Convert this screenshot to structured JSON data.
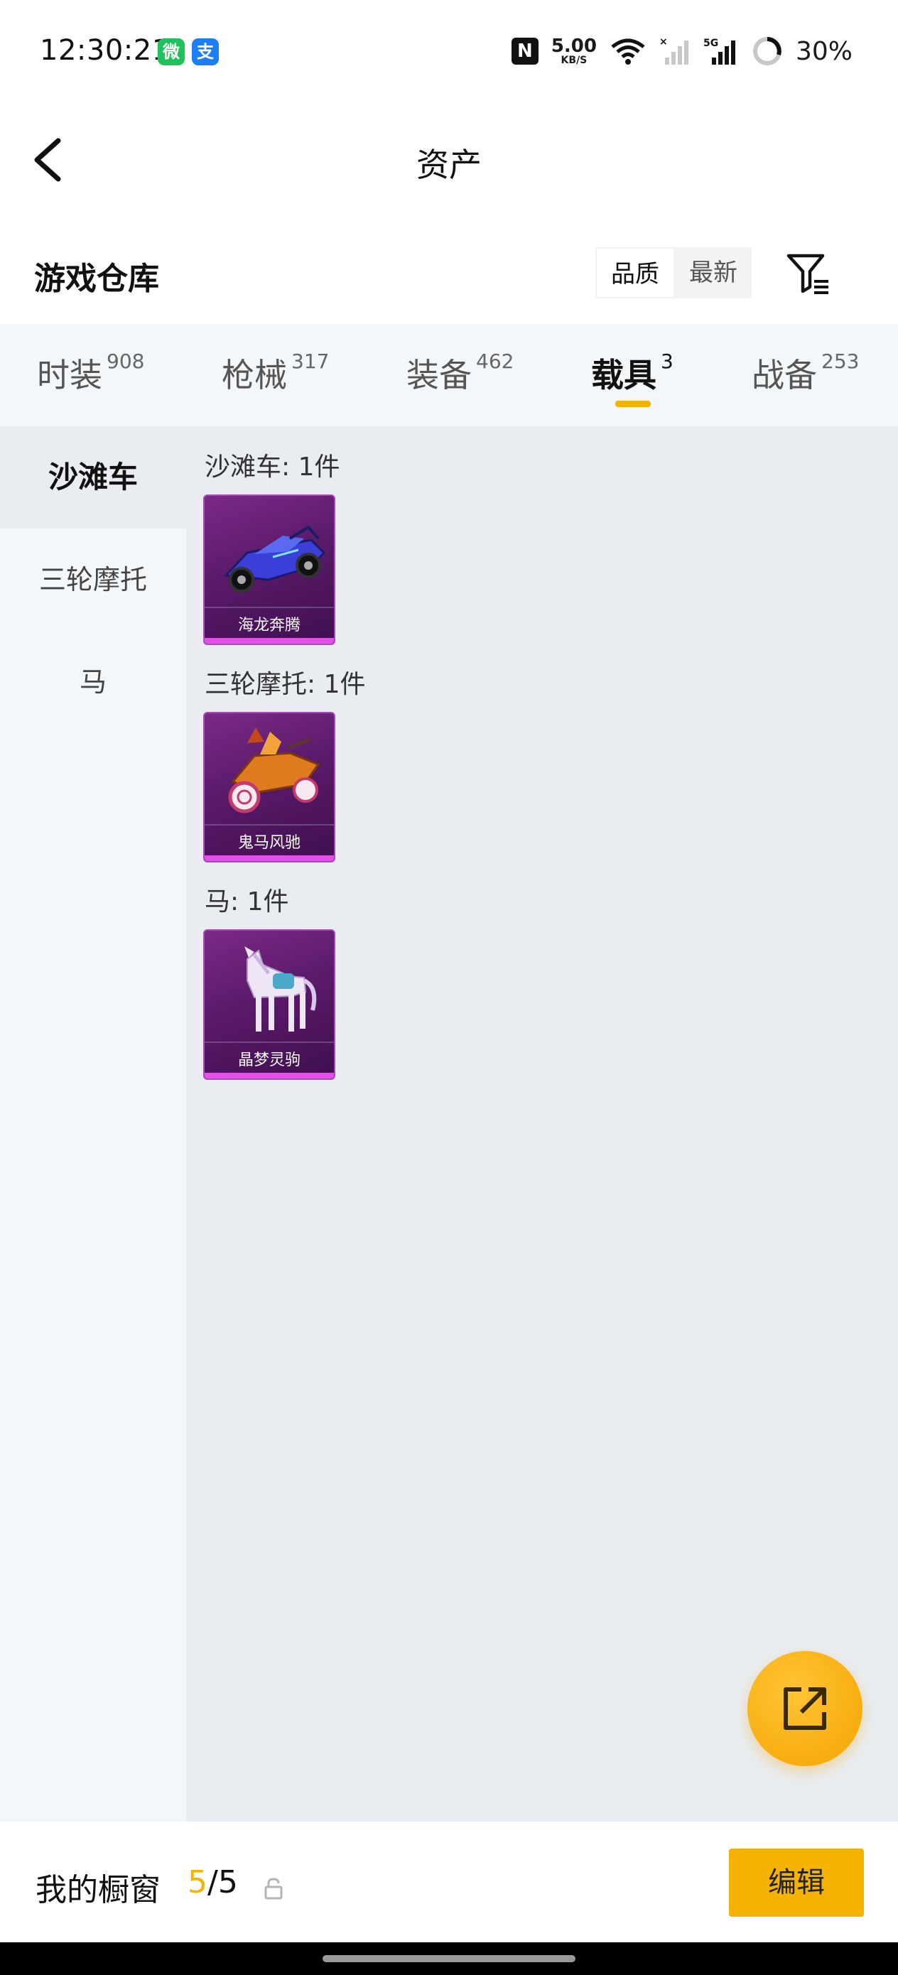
{
  "status_bar": {
    "time": "12:30:21",
    "app_badge_1": "微",
    "app_badge_2": "支",
    "nfc": "N",
    "net_speed": "5.00",
    "net_unit": "KB/S",
    "battery": "30%",
    "icons": [
      "wechat-icon",
      "alipay-icon",
      "nfc-icon",
      "wifi-icon",
      "signal-icon",
      "5g-signal-icon",
      "battery-icon"
    ]
  },
  "header": {
    "title": "资产"
  },
  "section": {
    "title": "游戏仓库",
    "sort_quality": "品质",
    "sort_latest": "最新"
  },
  "tabs": [
    {
      "label": "时装",
      "count": "908"
    },
    {
      "label": "枪械",
      "count": "317"
    },
    {
      "label": "装备",
      "count": "462"
    },
    {
      "label": "载具",
      "count": "3"
    },
    {
      "label": "战备",
      "count": "253"
    }
  ],
  "active_tab": "载具",
  "side_menu": [
    {
      "label": "沙滩车"
    },
    {
      "label": "三轮摩托"
    },
    {
      "label": "马"
    }
  ],
  "groups": [
    {
      "title": "沙滩车: 1件",
      "items": [
        {
          "name": "海龙奔腾"
        }
      ]
    },
    {
      "title": "三轮摩托: 1件",
      "items": [
        {
          "name": "鬼马风驰"
        }
      ]
    },
    {
      "title": "马: 1件",
      "items": [
        {
          "name": "晶梦灵驹"
        }
      ]
    }
  ],
  "bottom": {
    "showcase_label": "我的橱窗",
    "showcase_current": "5",
    "showcase_sep": "/",
    "showcase_total": "5",
    "edit_label": "编辑"
  },
  "colors": {
    "accent": "#f5b301",
    "card_purple": "#5b1a6a",
    "card_strip": "#e34fe8"
  }
}
